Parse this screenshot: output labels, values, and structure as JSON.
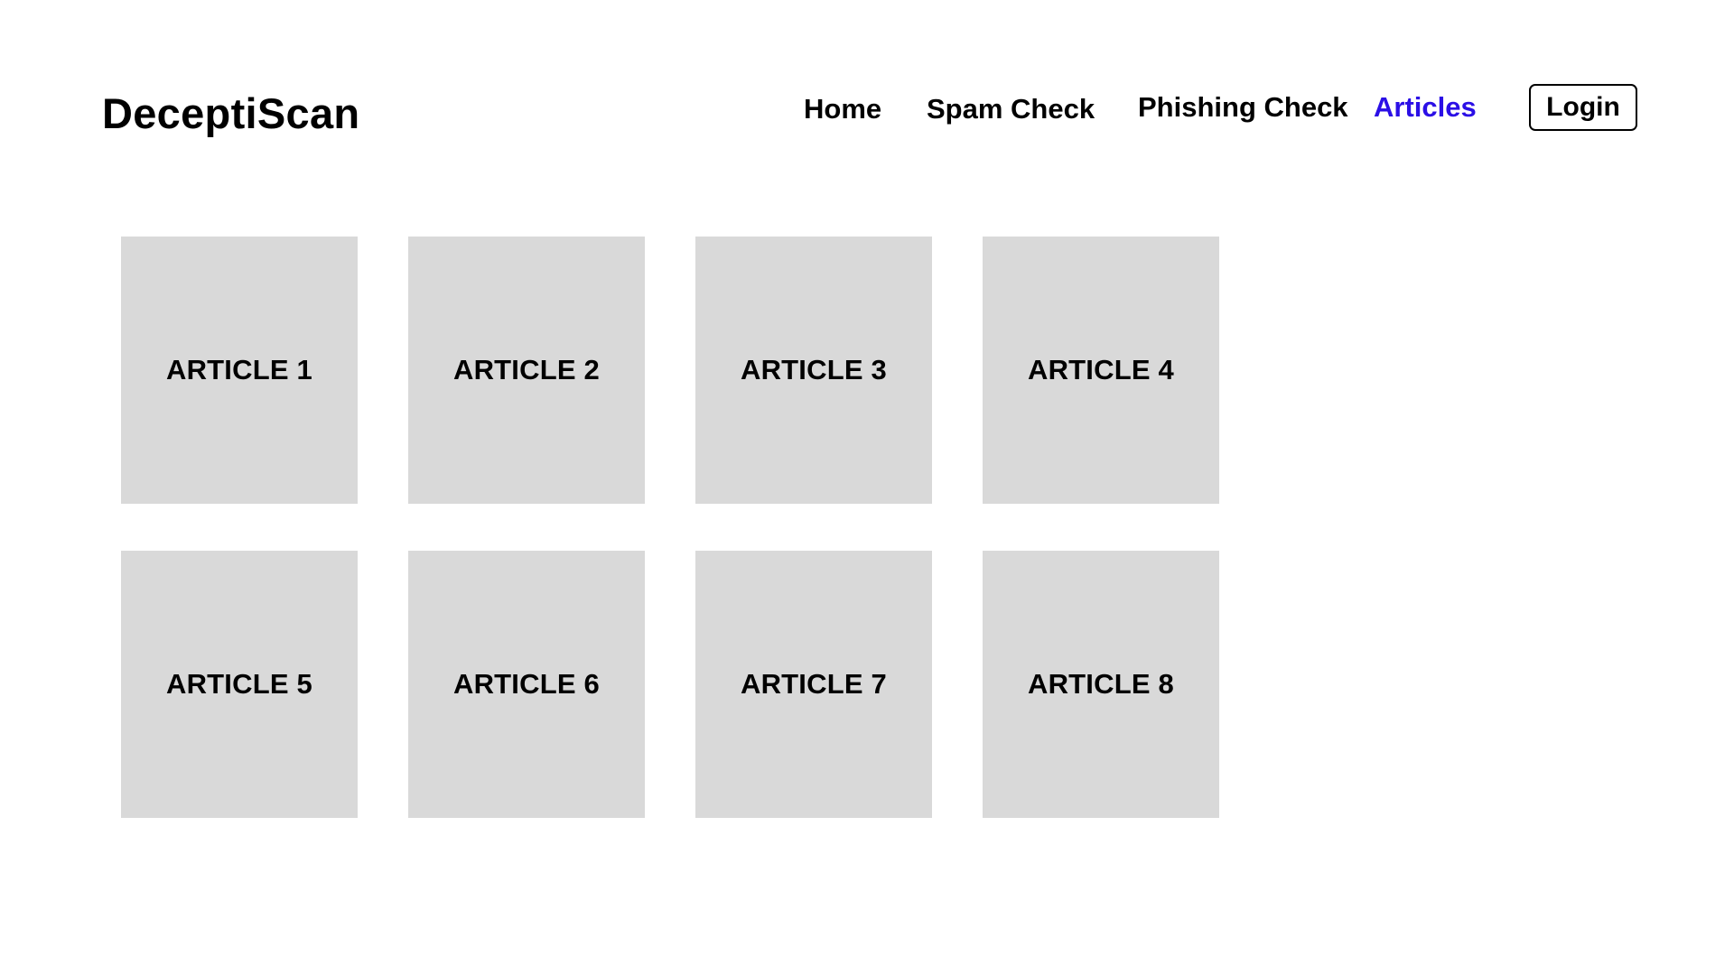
{
  "header": {
    "brand": "DeceptiScan",
    "nav": {
      "home": "Home",
      "spam_check": "Spam Check",
      "phishing_check": "Phishing Check",
      "articles": "Articles",
      "active": "articles"
    },
    "login_label": "Login"
  },
  "colors": {
    "active_nav": "#2b0fe6",
    "text": "#000000",
    "card_background": "#d9d9d9",
    "page_background": "#ffffff"
  },
  "articles": [
    {
      "title": "ARTICLE 1"
    },
    {
      "title": "ARTICLE 2"
    },
    {
      "title": "ARTICLE 3"
    },
    {
      "title": "ARTICLE 4"
    },
    {
      "title": "ARTICLE 5"
    },
    {
      "title": "ARTICLE 6"
    },
    {
      "title": "ARTICLE 7"
    },
    {
      "title": "ARTICLE 8"
    }
  ]
}
